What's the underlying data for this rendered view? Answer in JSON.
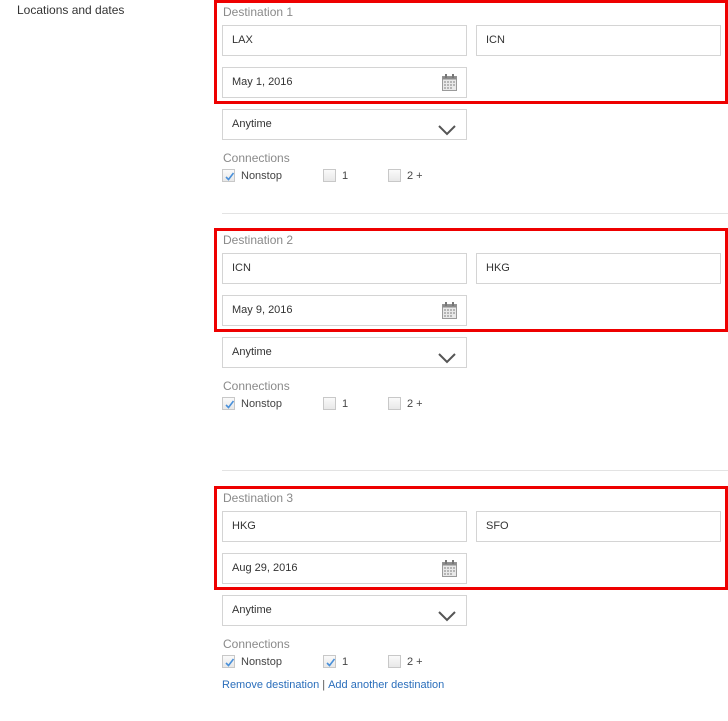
{
  "section_label": "Locations and dates",
  "destinations": [
    {
      "title": "Destination 1",
      "from": "LAX",
      "to": "ICN",
      "date": "May 1, 2016",
      "time": "Anytime",
      "connections_label": "Connections",
      "connections": [
        {
          "label": "Nonstop",
          "checked": true
        },
        {
          "label": "1",
          "checked": false
        },
        {
          "label": "2 +",
          "checked": false
        }
      ]
    },
    {
      "title": "Destination 2",
      "from": "ICN",
      "to": "HKG",
      "date": "May 9, 2016",
      "time": "Anytime",
      "connections_label": "Connections",
      "connections": [
        {
          "label": "Nonstop",
          "checked": true
        },
        {
          "label": "1",
          "checked": false
        },
        {
          "label": "2 +",
          "checked": false
        }
      ]
    },
    {
      "title": "Destination 3",
      "from": "HKG",
      "to": "SFO",
      "date": "Aug 29, 2016",
      "time": "Anytime",
      "connections_label": "Connections",
      "connections": [
        {
          "label": "Nonstop",
          "checked": true
        },
        {
          "label": "1",
          "checked": true
        },
        {
          "label": "2 +",
          "checked": false
        }
      ]
    }
  ],
  "links": {
    "remove": "Remove destination",
    "separator": "|",
    "add": "Add another destination"
  },
  "colors": {
    "highlight": "#ee0000",
    "link": "#2a6ebb",
    "check": "#4a90d9"
  }
}
